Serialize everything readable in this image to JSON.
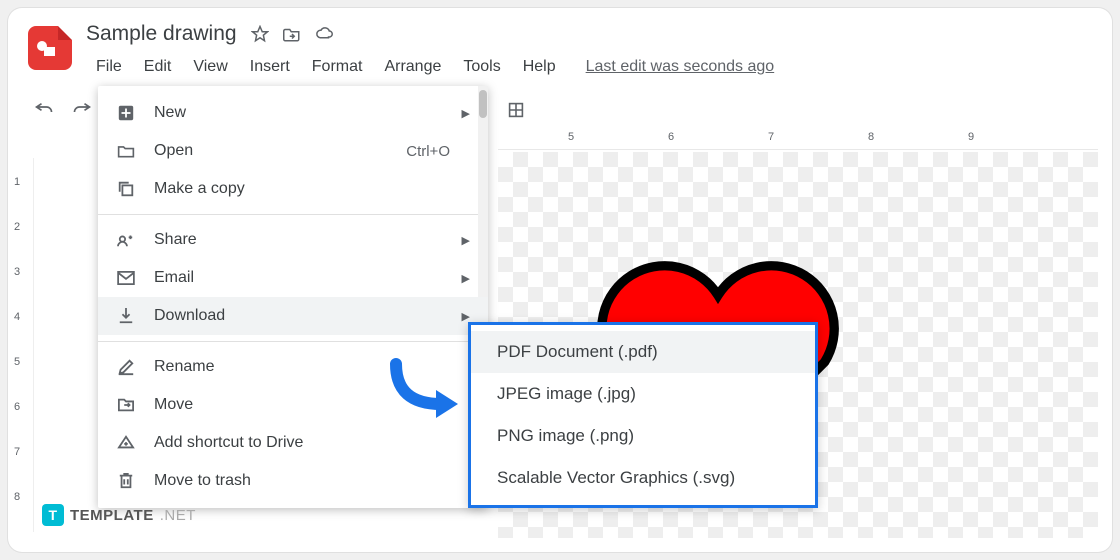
{
  "doc": {
    "title": "Sample drawing"
  },
  "menubar": {
    "items": [
      "File",
      "Edit",
      "View",
      "Insert",
      "Format",
      "Arrange",
      "Tools",
      "Help"
    ],
    "last_edit": "Last edit was seconds ago"
  },
  "file_menu": {
    "new": {
      "label": "New"
    },
    "open": {
      "label": "Open",
      "shortcut": "Ctrl+O"
    },
    "make_copy": {
      "label": "Make a copy"
    },
    "share": {
      "label": "Share"
    },
    "email": {
      "label": "Email"
    },
    "download": {
      "label": "Download"
    },
    "rename": {
      "label": "Rename"
    },
    "move": {
      "label": "Move"
    },
    "add_shortcut": {
      "label": "Add shortcut to Drive"
    },
    "trash": {
      "label": "Move to trash"
    }
  },
  "download_submenu": {
    "pdf": "PDF Document (.pdf)",
    "jpg": "JPEG image (.jpg)",
    "png": "PNG image (.png)",
    "svg": "Scalable Vector Graphics (.svg)"
  },
  "ruler": {
    "ticks": [
      "5",
      "6",
      "7",
      "8",
      "9"
    ]
  },
  "left_ruler": [
    "1",
    "2",
    "3",
    "4",
    "5",
    "6",
    "7",
    "8"
  ],
  "watermark": {
    "brand": "TEMPLATE",
    "suffix": ".NET"
  }
}
